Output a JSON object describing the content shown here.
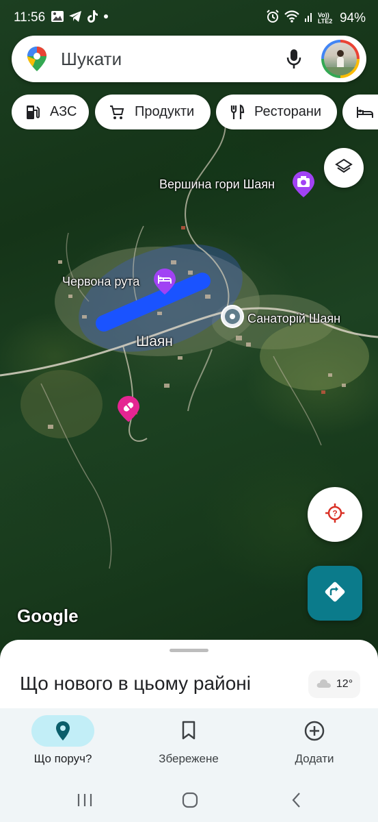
{
  "status_bar": {
    "time": "11:56",
    "left_icons": [
      "gallery-icon",
      "telegram-icon",
      "tiktok-icon",
      "dot-icon"
    ],
    "right_icons": [
      "alarm-icon",
      "wifi-icon",
      "signal-icon",
      "volte-icon"
    ],
    "volte_text": "Vo)) LTE2",
    "battery": "94%"
  },
  "search": {
    "placeholder": "Шукати",
    "icons": [
      "maps-pin-icon",
      "mic-icon",
      "avatar"
    ]
  },
  "chips": [
    {
      "label": "АЗС",
      "icon": "fuel-icon"
    },
    {
      "label": "Продукти",
      "icon": "cart-icon"
    },
    {
      "label": "Ресторани",
      "icon": "restaurant-icon"
    },
    {
      "label": "",
      "icon": "hotel-icon"
    }
  ],
  "map": {
    "labels": {
      "peak": "Вершина гори Шаян",
      "hotel": "Червона рута",
      "sanatorium": "Санаторій Шаян",
      "village": "Шаян"
    },
    "watermark": "Google",
    "colors": {
      "poi_purple": "#a142f4",
      "poi_pink": "#e52592",
      "route_blue": "#1a53ff",
      "directions_teal": "#0b7b8b"
    }
  },
  "sheet": {
    "title": "Що нового в цьому районі",
    "weather": "12°"
  },
  "bottom_nav": {
    "items": [
      {
        "label": "Що поруч?",
        "icon": "place-icon",
        "active": true
      },
      {
        "label": "Збережене",
        "icon": "bookmark-icon",
        "active": false
      },
      {
        "label": "Додати",
        "icon": "add-circle-icon",
        "active": false
      }
    ]
  },
  "system_nav": [
    "recents-button",
    "home-button",
    "back-button"
  ]
}
